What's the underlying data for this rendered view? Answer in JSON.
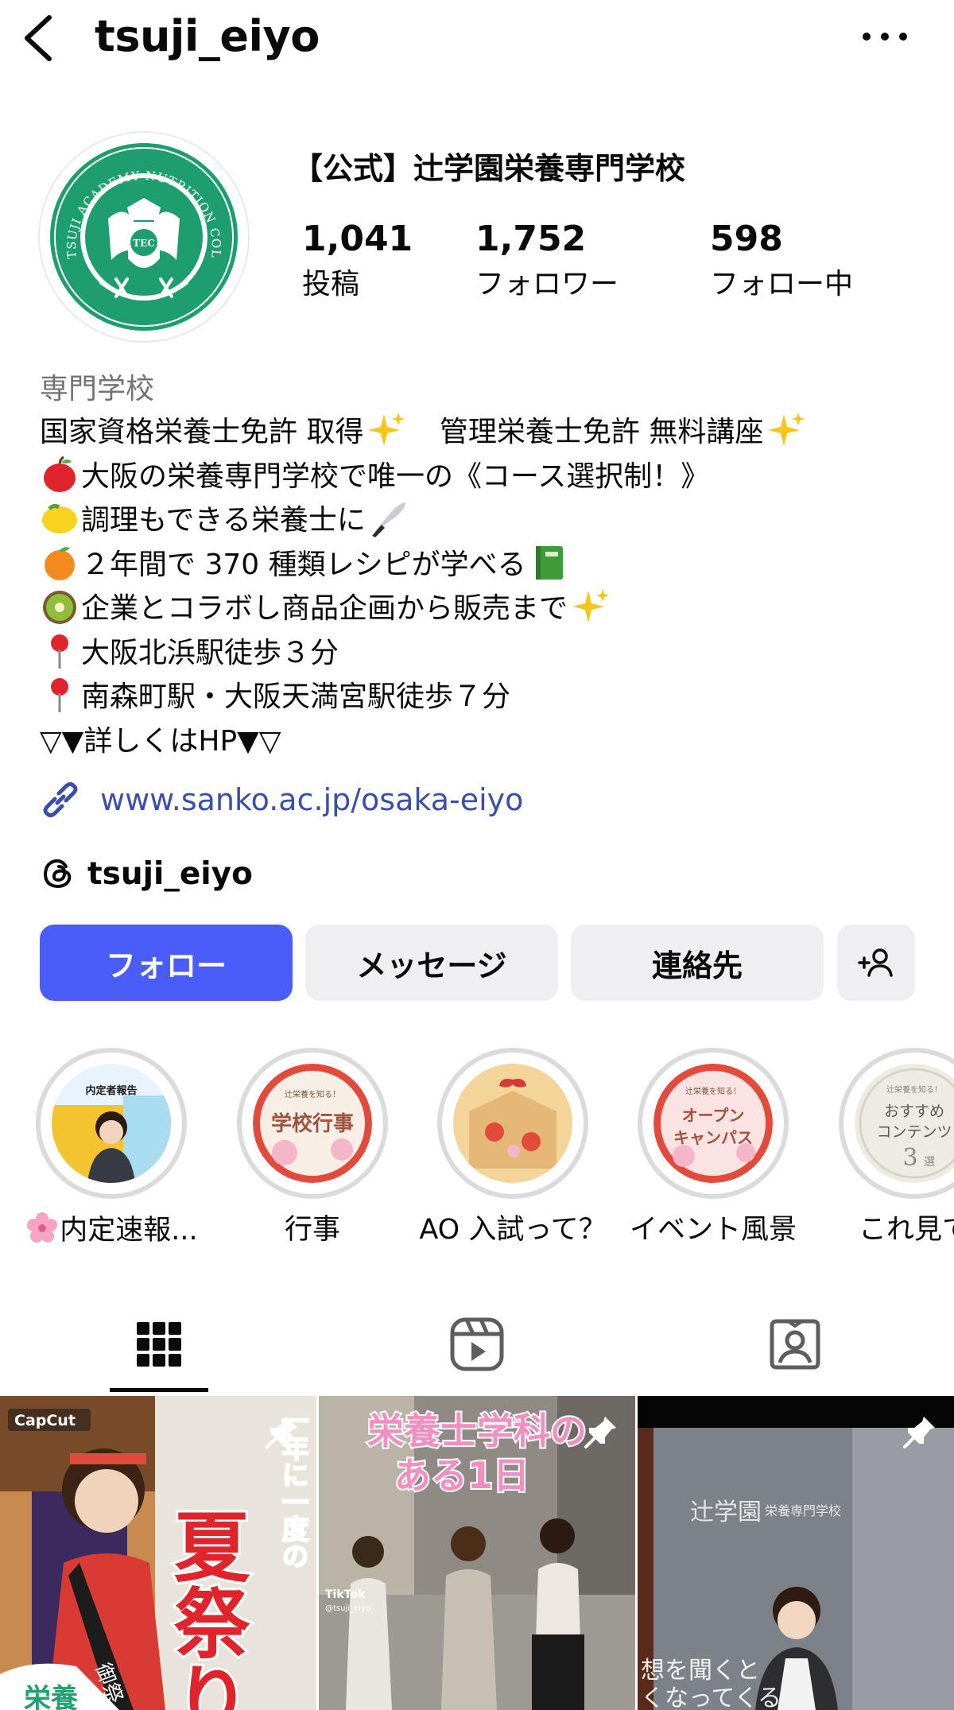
{
  "header": {
    "username": "tsuji_eiyo"
  },
  "profile": {
    "display_name": "【公式】辻学園栄養専門学校",
    "avatar_text": "TSUJI ACADEMY NUTRITION COLLEGE",
    "avatar_emblem": "TEC",
    "stats": [
      {
        "value": "1,041",
        "label": "投稿"
      },
      {
        "value": "1,752",
        "label": "フォロワー"
      },
      {
        "value": "598",
        "label": "フォロー中"
      }
    ]
  },
  "bio": {
    "category": "専門学校",
    "lines": [
      "国家資格栄養士免許 取得",
      "管理栄養士免許 無料講座",
      "大阪の栄養専門学校で唯一の《コース選択制！》",
      "調理もできる栄養士に",
      "２年間で 370 種類レシピが学べる",
      "企業とコラボし商品企画から販売まで",
      "大阪北浜駅徒歩３分",
      "南森町駅・大阪天満宮駅徒歩７分",
      "▽▼詳しくはHP▼▽"
    ]
  },
  "website": {
    "url": "www.sanko.ac.jp/osaka-eiyo"
  },
  "threads": {
    "handle": "tsuji_eiyo"
  },
  "actions": {
    "follow": "フォロー",
    "message": "メッセージ",
    "contact": "連絡先"
  },
  "highlights": [
    {
      "label": "内定速報...",
      "cover_text": "内定者報告"
    },
    {
      "label": "行事",
      "cover_sub": "辻栄養を知る！",
      "cover_text": "学校行事"
    },
    {
      "label": "AO 入試って？"
    },
    {
      "label": "イベント風景",
      "cover_sub": "辻栄養を知る！",
      "cover_text": "オープン キャンパス"
    },
    {
      "label": "これ見て",
      "cover_sub": "辻栄養を知る！",
      "cover_text": "おすすめ コンテンツ",
      "cover_num": "3",
      "cover_unit": "選"
    }
  ],
  "posts": [
    {
      "badge": "CapCut",
      "vertical_text": "一年に一度の",
      "big_text": "夏祭り",
      "corner_text": "栄養",
      "sash_text": "御祭"
    },
    {
      "title_line1": "栄養士学科の",
      "title_line2": "ある1日",
      "watermark": "TikTok",
      "watermark_handle": "@tsuji_eiyo"
    },
    {
      "sign_text": "辻学園",
      "sign_sub": "栄養専門学校",
      "caption_line1": "想を聞くと",
      "caption_line2": "くなってくる"
    }
  ],
  "colors": {
    "follow_blue": "#4a5df9",
    "link_blue": "#3c4fa8",
    "brand_green": "#1e9e6e",
    "button_gray": "#efeff1"
  }
}
